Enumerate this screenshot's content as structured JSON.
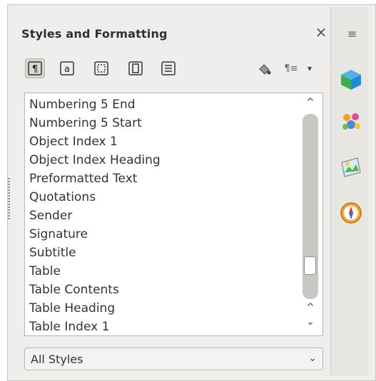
{
  "panel": {
    "title": "Styles and Formatting",
    "close_icon": "×"
  },
  "toolbar": {
    "buttons": [
      {
        "icon": "paragraph-styles-icon",
        "glyph": "¶",
        "active": true
      },
      {
        "icon": "character-styles-icon",
        "glyph": "a",
        "active": false
      },
      {
        "icon": "frame-styles-icon",
        "glyph": "⬚",
        "active": false
      },
      {
        "icon": "page-styles-icon",
        "glyph": "D",
        "active": false
      },
      {
        "icon": "list-styles-icon",
        "glyph": "≡",
        "active": false
      }
    ],
    "fill_format_icon": "paint-bucket-icon",
    "new_style_icon": "¶≡",
    "menu_caret": "▾"
  },
  "styles_list": {
    "items": [
      "Numbering 5 End",
      "Numbering 5 Start",
      "Object Index 1",
      "Object Index Heading",
      "Preformatted Text",
      "Quotations",
      "Sender",
      "Signature",
      "Subtitle",
      "Table",
      "Table Contents",
      "Table Heading",
      "Table Index 1"
    ]
  },
  "filter": {
    "selected": "All Styles",
    "caret": "⌄"
  },
  "sidebar": {
    "menu_icon": "≡",
    "icons": [
      "properties-cube-icon",
      "styles-people-icon",
      "gallery-image-icon",
      "navigator-compass-icon"
    ]
  }
}
